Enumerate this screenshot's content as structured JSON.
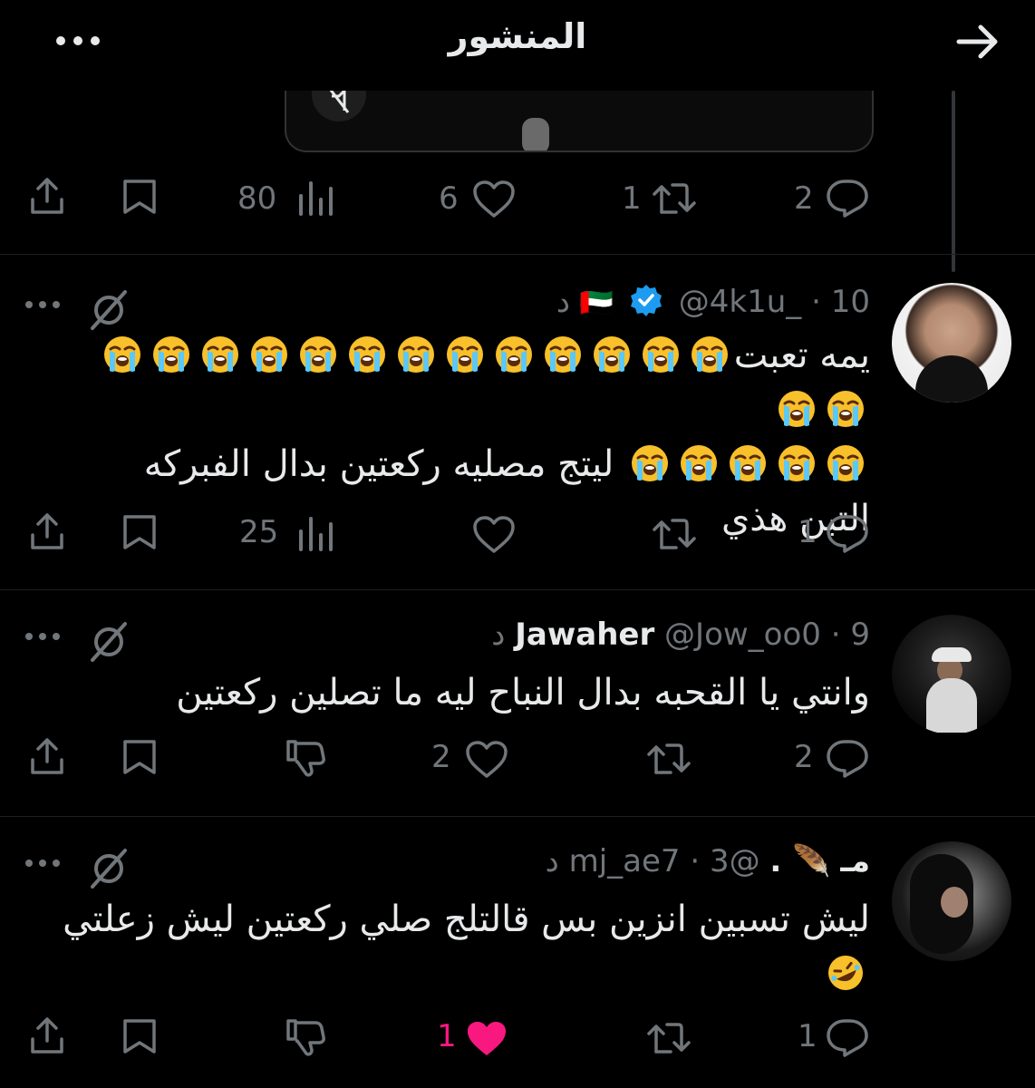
{
  "header": {
    "title": "المنشور"
  },
  "colors": {
    "background": "#000000",
    "text": "#e7e9ea",
    "muted": "#71767b",
    "like": "#f91880",
    "verified": "#1d9bf0"
  },
  "post_stats": {
    "replies": "2",
    "reposts": "1",
    "likes": "6",
    "views": "80"
  },
  "replies": [
    {
      "flag": "🇦🇪",
      "handle": "@4k1u_",
      "sep": "·",
      "time": "10 د",
      "verified": true,
      "line1": "يمه تعبت",
      "line2": "ليتج مصليه ركعتين بدال الفبركه",
      "line3": "التبن هذي",
      "emoji_line1_count": 15,
      "emoji_line2_count": 5,
      "emoji_name": "loudly-crying-face",
      "stats": {
        "replies": "1",
        "reposts": "",
        "likes": "",
        "views": "25"
      }
    },
    {
      "name": "Jawaher",
      "handle": "@Jow_oo0",
      "sep": "·",
      "time": "9 د",
      "line1": "وانتي يا القحبه بدال النباح ليه ما تصلين ركعتين",
      "stats": {
        "replies": "2",
        "reposts": "",
        "likes": "2"
      }
    },
    {
      "name": "مـ",
      "name_suffix": "🪶 .",
      "handle": "@mj_ae7",
      "sep": "·",
      "time": "3 د",
      "line1": "ليش تسبين انزين بس قالتلج صلي ركعتين ليش زعلتي",
      "emoji_name": "rolling-on-the-floor-laughing",
      "stats": {
        "replies": "1",
        "reposts": "",
        "likes": "1",
        "liked": true
      }
    }
  ]
}
